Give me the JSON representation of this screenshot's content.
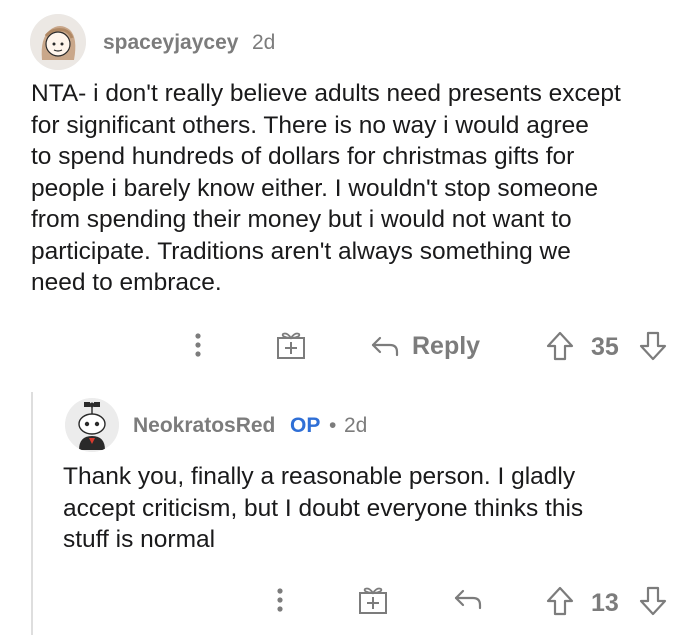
{
  "comment": {
    "username": "spaceyjaycey",
    "age": "2d",
    "lines": [
      "NTA- i don't really believe adults need presents except",
      "for significant others. There is no way i would agree",
      "to spend hundreds of dollars for christmas gifts for",
      "people i barely know either. I wouldn't stop someone",
      "from spending their money but i would not want to",
      "participate. Traditions aren't always something we",
      "need to embrace."
    ],
    "actions": {
      "reply_label": "Reply",
      "vote_count": "35"
    }
  },
  "reply": {
    "username": "NeokratosRed",
    "op_badge": "OP",
    "separator": "•",
    "age": "2d",
    "lines": [
      "Thank you, finally a reasonable person. I gladly",
      "accept criticism, but I doubt everyone thinks this",
      "stuff is normal"
    ],
    "actions": {
      "vote_count": "13"
    }
  },
  "colors": {
    "meta_gray": "#7c7c7c",
    "text": "#1a1a1b",
    "op_blue": "#2f6fd6",
    "thread_line": "#dedede"
  },
  "icons": [
    "more-icon",
    "award-icon",
    "reply-arrow-icon",
    "upvote-icon",
    "downvote-icon"
  ]
}
